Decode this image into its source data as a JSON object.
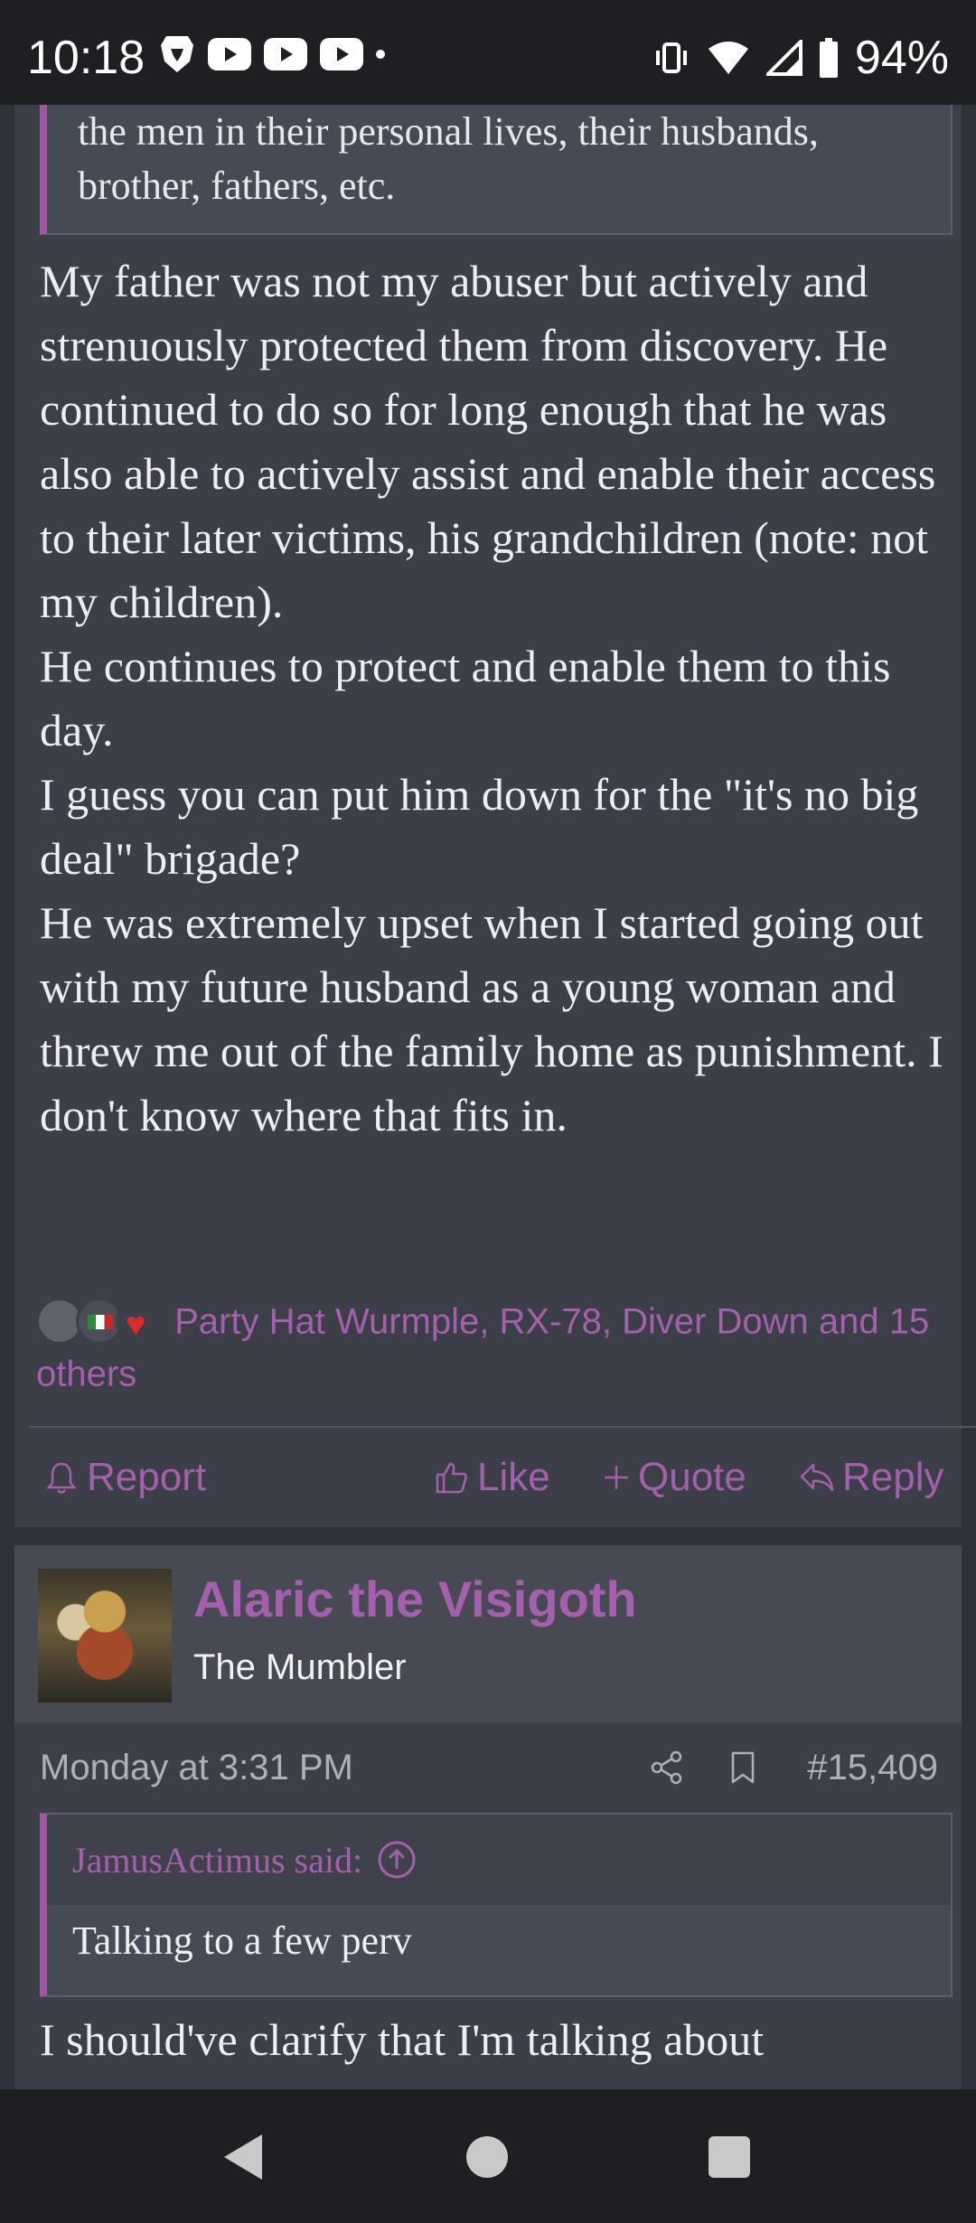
{
  "status_bar": {
    "time": "10:18",
    "battery": "94%"
  },
  "post1": {
    "quote_text": "the men in their personal lives, their husbands, brother, fathers, etc.",
    "paragraphs": [
      "My father was not my abuser but actively and strenuously protected them from discovery. He continued to do so for long enough that he was also able to actively assist and enable their access to their later victims, his grandchildren (note: not my children).",
      "He continues to protect and enable them to this day.",
      "I guess you can put him down for the \"it's no big deal\" brigade?",
      "He was extremely upset when I started going out with my future husband as a young woman and threw me out of the family home as punishment. I don't know where that fits in."
    ],
    "reactions_text": "Party Hat Wurmple, RX-78, Diver Down and 15 others",
    "actions": {
      "report": "Report",
      "like": "Like",
      "quote": "Quote",
      "reply": "Reply"
    }
  },
  "post2": {
    "username": "Alaric the Visigoth",
    "user_title": "The Mumbler",
    "date": "Monday at 3:31 PM",
    "post_number": "#15,409",
    "quote_author": "JamusActimus said:",
    "quote_text": "Talking to a few perv",
    "body": "I should've clarify that I'm talking about"
  },
  "colors": {
    "accent": "#a560ad",
    "post_bg": "#3c3f48",
    "page_bg": "#30323a"
  }
}
